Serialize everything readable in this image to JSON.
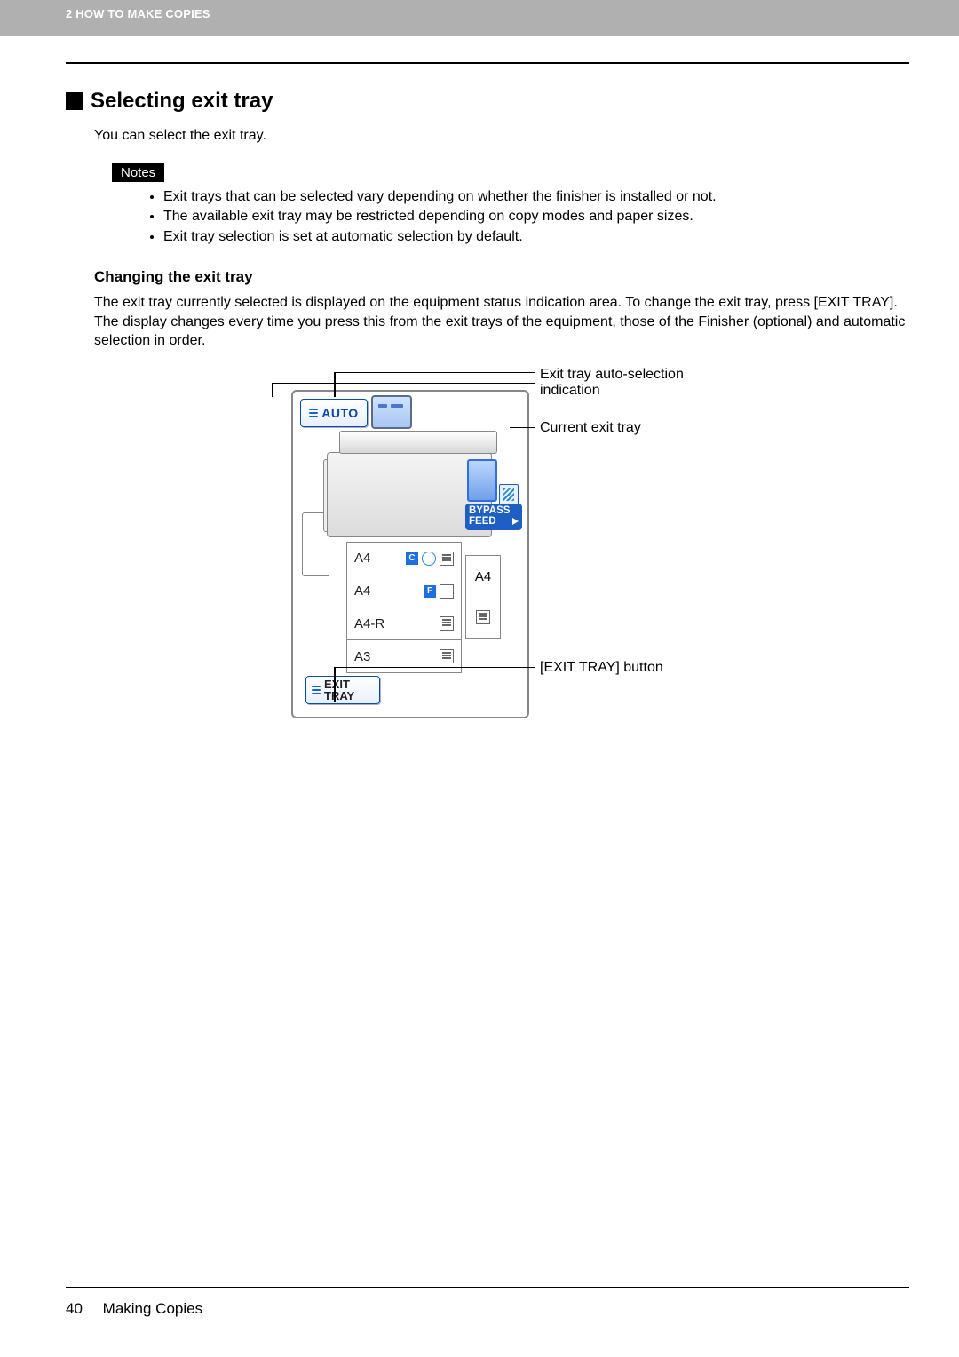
{
  "header": {
    "chapter": "2 HOW TO MAKE COPIES"
  },
  "section": {
    "title": "Selecting exit tray",
    "intro": "You can select the exit tray.",
    "notes_label": "Notes",
    "notes": [
      "Exit trays that can be selected vary depending on whether the finisher is installed or not.",
      "The available exit tray may be restricted depending on copy modes and paper sizes.",
      "Exit tray selection is set at automatic selection by default."
    ],
    "subhead": "Changing the exit tray",
    "body": "The exit tray currently selected is displayed on the equipment status indication area. To change the exit tray, press [EXIT TRAY]. The display changes every time you press this from the exit trays of the equipment, those of the Finisher (optional) and automatic selection in order."
  },
  "diagram": {
    "auto_button": "AUTO",
    "bypass_line1": "BYPASS",
    "bypass_line2": "FEED",
    "trays": [
      "A4",
      "A4",
      "A4-R",
      "A3"
    ],
    "side_tray_label": "A4",
    "exit_button_line1": "EXIT",
    "exit_button_line2": "TRAY",
    "callouts": {
      "auto_indication": "Exit tray auto-selection indication",
      "current": "Current exit tray",
      "exit_button": "[EXIT TRAY] button"
    }
  },
  "footer": {
    "page": "40",
    "title": "Making Copies"
  }
}
